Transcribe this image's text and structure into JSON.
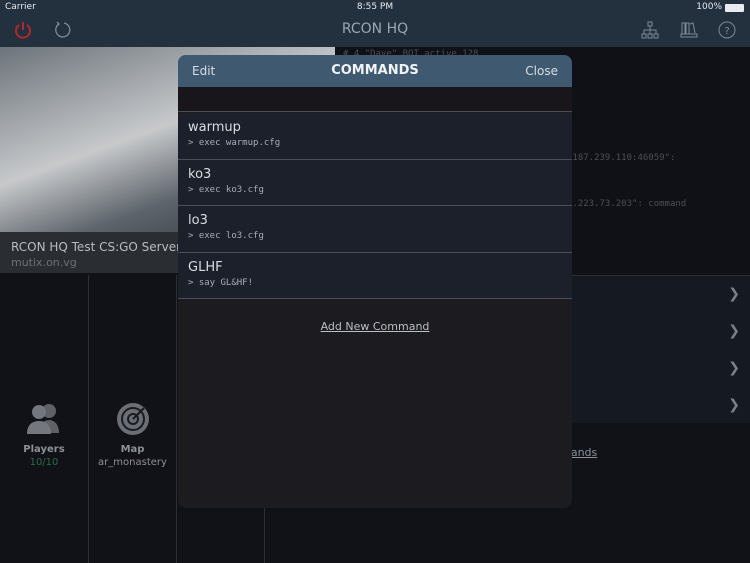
{
  "status_bar": {
    "carrier": "Carrier",
    "time": "8:55 PM",
    "battery": "100%"
  },
  "nav": {
    "title": "RCON HQ",
    "icons": [
      "power-icon",
      "refresh-icon",
      "network-icon",
      "library-icon",
      "help-icon"
    ],
    "power_color": "#b3262b"
  },
  "server": {
    "name": "RCON HQ Test CS:GO Server",
    "host": "mutix.on.vg"
  },
  "console": {
    "lines": [
      "# 4 \"Dave\" BOT active 128",
      ".187.239.110:46059\":",
      "8.223.73.203\": command"
    ]
  },
  "tiles": [
    {
      "label": "Players",
      "value": "10/10",
      "value_color": "#2f6b4a"
    },
    {
      "label": "Map",
      "value": "ar_monastery"
    }
  ],
  "commands_link": "Commands",
  "modal": {
    "title": "COMMANDS",
    "edit": "Edit",
    "close": "Close",
    "commands": [
      {
        "name": "warmup",
        "exec": "> exec warmup.cfg"
      },
      {
        "name": "ko3",
        "exec": "> exec ko3.cfg"
      },
      {
        "name": "lo3",
        "exec": "> exec lo3.cfg"
      },
      {
        "name": "GLHF",
        "exec": "> say GL&HF!"
      }
    ],
    "add_label": "Add New Command"
  }
}
